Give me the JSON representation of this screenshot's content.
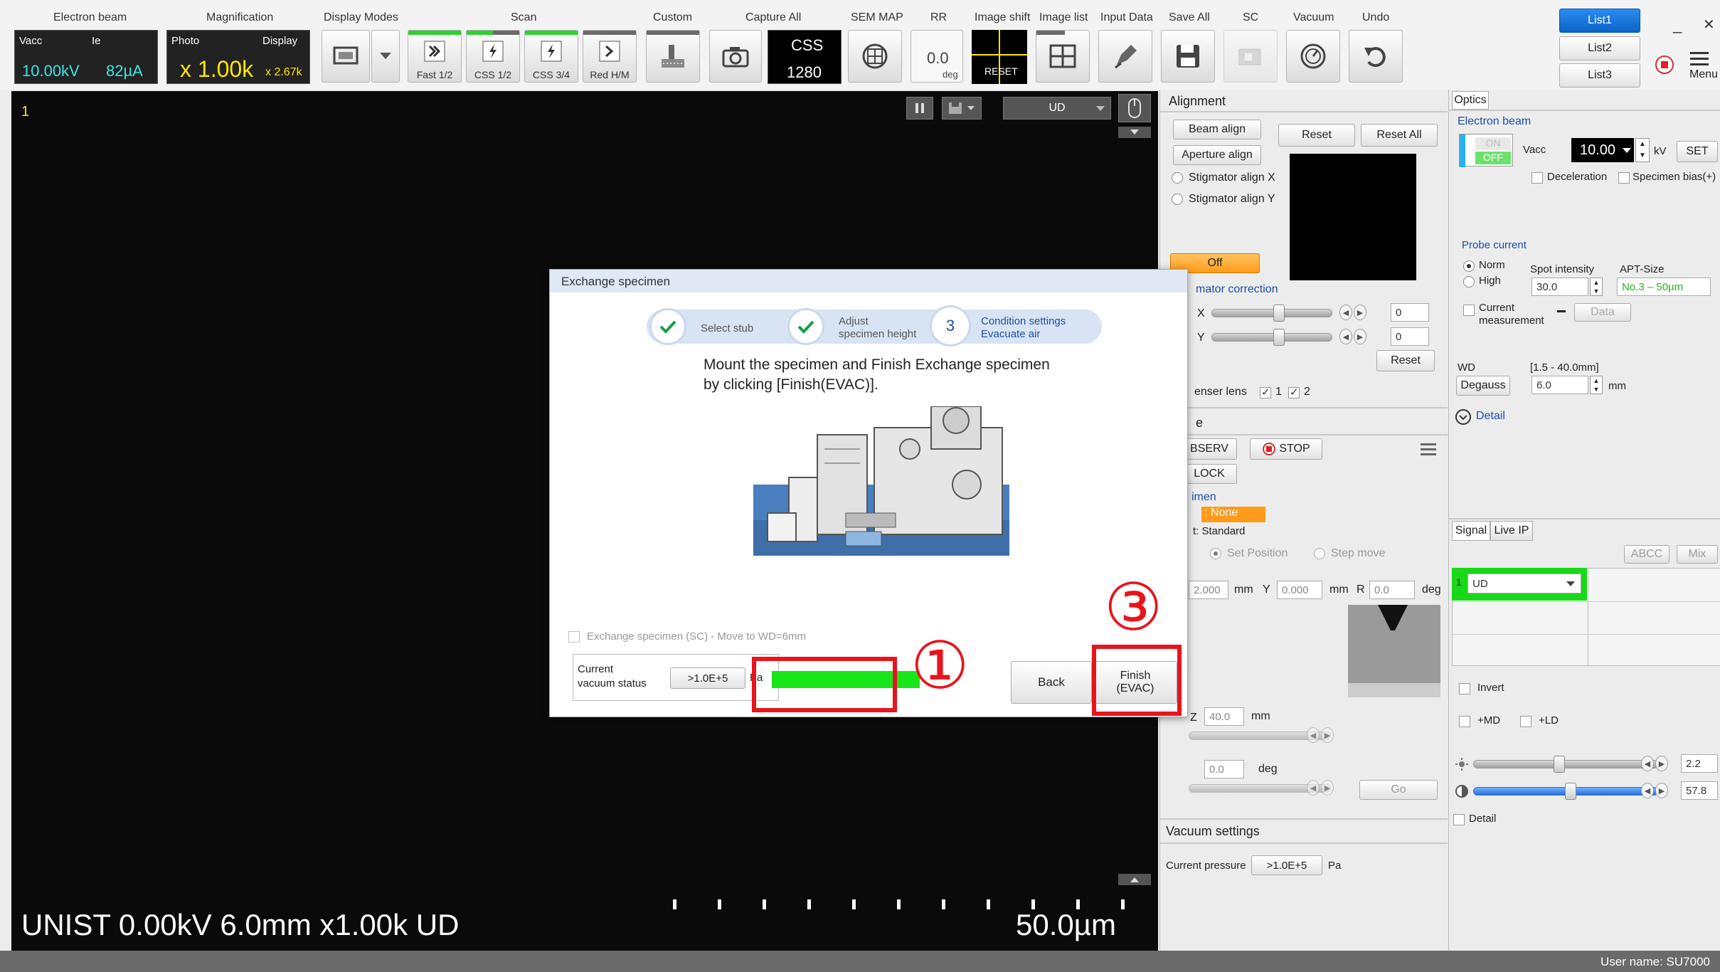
{
  "toolbar": {
    "electron_beam": {
      "caption": "Electron beam",
      "vacc_label": "Vacc",
      "ie_label": "Ie",
      "vacc_value": "10.00kV",
      "ie_value": "82µA"
    },
    "magnification": {
      "caption": "Magnification",
      "photo_label": "Photo",
      "display_label": "Display",
      "photo_value": "x 1.00k",
      "display_value": "x 2.67k"
    },
    "display_modes": {
      "caption": "Display Modes"
    },
    "scan": {
      "caption": "Scan",
      "fast": "Fast 1/2",
      "css12": "CSS 1/2",
      "css34": "CSS 3/4",
      "red": "Red H/M"
    },
    "custom": {
      "caption": "Custom"
    },
    "capture_all": {
      "caption": "Capture All",
      "css_label": "CSS",
      "css_value": "1280"
    },
    "sem_map": {
      "caption": "SEM MAP"
    },
    "rr": {
      "caption": "RR",
      "value": "0.0",
      "unit": "deg"
    },
    "image_shift": {
      "caption": "Image shift",
      "reset": "RESET"
    },
    "image_list": {
      "caption": "Image list"
    },
    "input_data": {
      "caption": "Input Data"
    },
    "save_all": {
      "caption": "Save All"
    },
    "sc": {
      "caption": "SC"
    },
    "vacuum": {
      "caption": "Vacuum"
    },
    "undo": {
      "caption": "Undo"
    },
    "lists": [
      "List1",
      "List2",
      "List3"
    ],
    "menu": "Menu",
    "minimize": "_",
    "close": "✕"
  },
  "viewer": {
    "frame_number": "1",
    "signal_select": "UD",
    "info_text": "UNIST 0.00kV 6.0mm x1.00k UD",
    "scale_text": "50.0µm"
  },
  "alignment": {
    "title": "Alignment",
    "beam_align": "Beam align",
    "aperture_align": "Aperture align",
    "reset": "Reset",
    "reset_all": "Reset All",
    "stig_x": "Stigmator align X",
    "stig_y": "Stigmator align Y",
    "off": "Off",
    "stig_correction": "mator correction",
    "x_label": "X",
    "y_label": "Y",
    "x_value": "0",
    "y_value": "0",
    "reset2": "Reset",
    "condenser": "enser lens",
    "cond_1": "1",
    "cond_2": "2"
  },
  "stage": {
    "title": "e",
    "observ": "BSERV",
    "stop": "STOP",
    "lock": "LOCK",
    "specimen": "imen",
    "none_label": ": None",
    "standard": "t: Standard",
    "set_position": "Set Position",
    "step_move": "Step move",
    "x_value": "2.000",
    "mm1": "mm",
    "y_label": "Y",
    "y_value": "0.000",
    "mm2": "mm",
    "r_label": "R",
    "r_value": "0.0",
    "deg1": "deg",
    "z_label": "Z",
    "z_value": "40.0",
    "mm3": "mm",
    "t_value": "0.0",
    "deg2": "deg",
    "go": "Go"
  },
  "vacuum_settings": {
    "title": "Vacuum settings",
    "current_pressure": "Current pressure",
    "value": ">1.0E+5",
    "unit": "Pa"
  },
  "optics": {
    "tab": "Optics",
    "electron_beam": "Electron beam",
    "on": "ON",
    "off": "OFF",
    "vacc": "Vacc",
    "vacc_value": "10.00",
    "kv": "kV",
    "set": "SET",
    "deceleration": "Deceleration",
    "specimen_bias": "Specimen bias(+)",
    "probe_current": "Probe current",
    "norm": "Norm",
    "high": "High",
    "spot_intensity": "Spot intensity",
    "spot_value": "30.0",
    "apt_size": "APT-Size",
    "apt_value": "No.3 – 50µm",
    "current_measurement_1": "Current",
    "current_measurement_2": "measurement",
    "data": "Data",
    "wd": "WD",
    "wd_range": "[1.5 - 40.0mm]",
    "degauss": "Degauss",
    "wd_value": "6.0",
    "mm": "mm",
    "detail": "Detail"
  },
  "signal": {
    "tab_signal": "Signal",
    "tab_liveip": "Live IP",
    "abcc": "ABCC",
    "mix": "Mix",
    "row_num": "1",
    "row_value": "UD",
    "invert": "Invert",
    "md": "+MD",
    "ld": "+LD",
    "brightness": "2.2",
    "contrast": "57.8",
    "detail": "Detail"
  },
  "dialog": {
    "title": "Exchange specimen",
    "step1": "Select stub",
    "step2_1": "Adjust",
    "step2_2": "specimen height",
    "step3_num": "3",
    "step3_1": "Condition settings",
    "step3_2": "Evacuate air",
    "message_1": "Mount the specimen and Finish Exchange specimen",
    "message_2": "by clicking [Finish(EVAC)].",
    "sc_option": "Exchange specimen (SC) - Move to WD=6mm",
    "vac_status_1": "Current",
    "vac_status_2": "vacuum status",
    "vac_value": ">1.0E+5",
    "vac_unit": "Pa",
    "back": "Back",
    "finish_1": "Finish",
    "finish_2": "(EVAC)"
  },
  "annotations": {
    "marker1": "①",
    "marker3": "③",
    "color": "#e8141b"
  },
  "status": {
    "user": "User name: SU7000"
  }
}
